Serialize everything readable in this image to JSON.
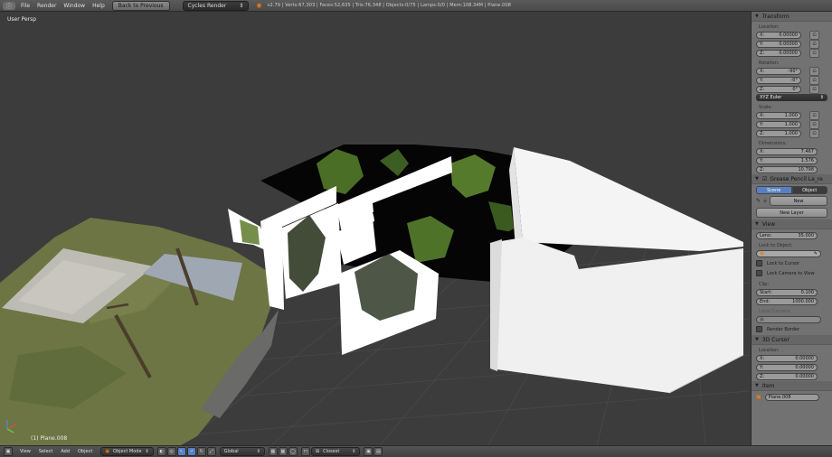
{
  "top_bar": {
    "menus": [
      "File",
      "Render",
      "Window",
      "Help"
    ],
    "back_button": "Back to Previous",
    "render_engine": "Cycles Render",
    "stats": "v2.79 | Verts:67,303 | Faces:52,635 | Tris:76,348 | Objects:0/75 | Lamps:0/0 | Mem:108.34M | Plane.008"
  },
  "viewport": {
    "view_label": "User Persp",
    "object_label": "(1) Plane.008"
  },
  "properties": {
    "transform": {
      "title": "Transform",
      "location_label": "Location:",
      "location": [
        [
          "X:",
          "0.00000"
        ],
        [
          "Y:",
          "0.00000"
        ],
        [
          "Z:",
          "0.00000"
        ]
      ],
      "rotation_label": "Rotation:",
      "rotation": [
        [
          "X:",
          "-90°"
        ],
        [
          "Y:",
          "-0°"
        ],
        [
          "Z:",
          "0°"
        ]
      ],
      "rotation_mode": "XYZ Euler",
      "scale_label": "Scale:",
      "scale": [
        [
          "X:",
          "1.000"
        ],
        [
          "Y:",
          "1.000"
        ],
        [
          "Z:",
          "1.000"
        ]
      ],
      "dimensions_label": "Dimensions:",
      "dimensions": [
        [
          "X:",
          "7.467"
        ],
        [
          "Y:",
          "1.576"
        ],
        [
          "Z:",
          "10.798"
        ]
      ]
    },
    "grease_pencil": {
      "title": "Grease Pencil La_re",
      "tab_scene": "Scene",
      "tab_object": "Object",
      "new_button": "New",
      "new_layer_button": "New Layer"
    },
    "view": {
      "title": "View",
      "lens_label": "Lens:",
      "lens_value": "35.000",
      "lock_to_object": "Lock to Object:",
      "lock_to_cursor": "Lock to Cursor",
      "lock_camera": "Lock Camera to View",
      "clip_label": "Clip:",
      "clip_start_label": "Start:",
      "clip_start": "0.100",
      "clip_end_label": "End:",
      "clip_end": "1000.000",
      "local_camera": "Local Camera:",
      "render_border": "Render Border"
    },
    "cursor": {
      "title": "3D Cursor",
      "location_label": "Location:",
      "location": [
        [
          "X:",
          "0.00000"
        ],
        [
          "Y:",
          "0.00000"
        ],
        [
          "Z:",
          "0.00000"
        ]
      ]
    },
    "item": {
      "title": "Item",
      "name": "Plane.008"
    }
  },
  "bottom_bar": {
    "menus": [
      "View",
      "Select",
      "Add",
      "Object"
    ],
    "mode": "Object Mode",
    "orientation": "Global",
    "snap_target": "Closest"
  },
  "colors": {
    "accent": "#5680c2",
    "viewport_bg": "#3c3c3c",
    "panel_bg": "#727272",
    "cube": "#f4f4f4"
  }
}
